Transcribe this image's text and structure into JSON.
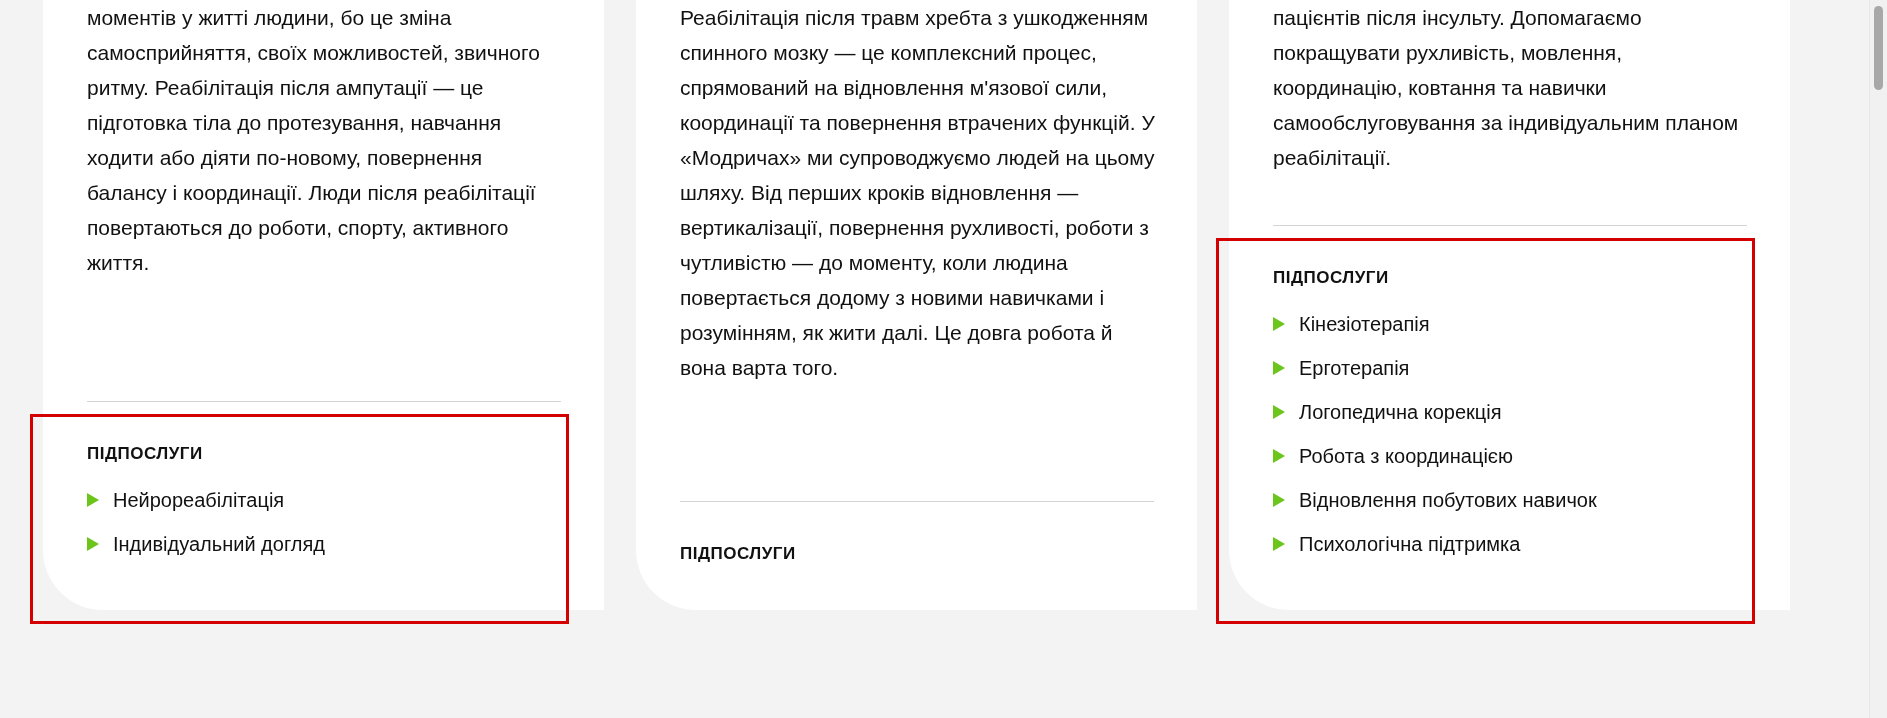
{
  "cards": [
    {
      "description": "моментів у житті людини, бо це зміна самосприйняття, своїх можливостей, звичного ритму. Реабілітація після ампутації — це підготовка тіла до протезування, навчання ходити або діяти по-новому, повернення балансу і координації. Люди після реабілітації повертаються до роботи, спорту, активного життя.",
      "subservices_heading": "ПІДПОСЛУГИ",
      "subservices": [
        "Нейрореабілітація",
        "Індивідуальний догляд"
      ],
      "highlighted": true
    },
    {
      "description": "Реабілітація після травм хребта з ушкодженням спинного мозку — це комплексний процес, спрямований на відновлення м'язової сили, координації та повернення втрачених функцій. У «Модричах» ми супроводжуємо людей на цьому шляху. Від перших кроків відновлення — вертикалізації, повернення рухливості, роботи з чутливістю — до моменту, коли людина повертається додому з новими навичками і розумінням, як жити далі. Це довга робота й вона варта того.",
      "subservices_heading": "ПІДПОСЛУГИ",
      "highlighted": false
    },
    {
      "description": "пацієнтів після інсульту. Допомагаємо покращувати рухливість, мовлення, координацію, ковтання та навички самообслуговування за індивідуальним планом реабілітації.",
      "subservices_heading": "ПІДПОСЛУГИ",
      "subservices": [
        "Кінезіотерапія",
        "Ерготерапія",
        "Логопедична корекція",
        "Робота з координацією",
        "Відновлення побутових навичок",
        "Психологічна підтримка"
      ],
      "highlighted": true
    }
  ]
}
